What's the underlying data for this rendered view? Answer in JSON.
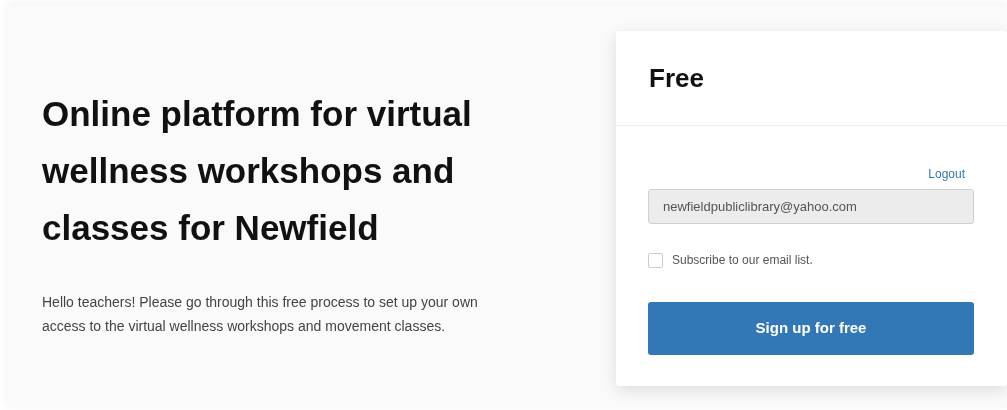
{
  "hero": {
    "title": "Online platform for virtual wellness workshops and classes for Newfield",
    "description": "Hello teachers! Please go through this free process to set up your own access to the virtual wellness workshops and movement classes."
  },
  "plan_card": {
    "title": "Free",
    "logout_link": "Logout",
    "email_field": {
      "value": "newfieldpubliclibrary@yahoo.com",
      "disabled": true
    },
    "subscribe_checkbox": {
      "label": "Subscribe to our email list.",
      "checked": false
    },
    "submit_button": "Sign up for free"
  }
}
